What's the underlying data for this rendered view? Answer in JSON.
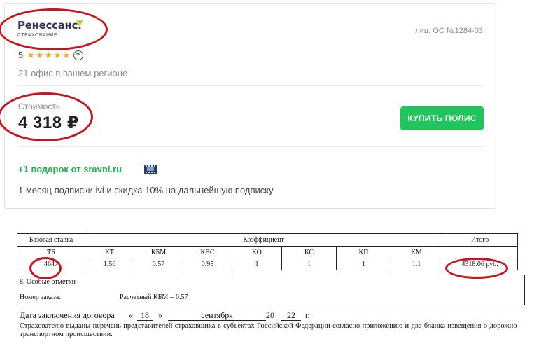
{
  "offer": {
    "brand": {
      "name": "Ренессанс.",
      "subtitle": "страхование"
    },
    "license": "лиц. ОС №1284-03",
    "rating": {
      "value": "5",
      "stars": 5,
      "help": "?"
    },
    "offices": "21 офис в вашем регионе",
    "cost_label": "Стоимость",
    "cost_value": "4 318 ₽",
    "buy_button": "КУПИТЬ ПОЛИС",
    "gift_title": "+1 подарок от sravni.ru",
    "gift_description": "1 месяц подписки ivi и скидка 10% на дальнейшую подписку",
    "colors": {
      "accent_green": "#21c55d",
      "gift_green": "#24b14f",
      "annotation_red": "#c4161c",
      "star": "#f5a623"
    }
  },
  "policy_table": {
    "headers": {
      "base_rate": "Базовая ставка",
      "coefficient": "Коэффициент",
      "total": "Итого"
    },
    "columns": [
      "ТБ",
      "КТ",
      "КБМ",
      "КВС",
      "КО",
      "КС",
      "КП",
      "КМ"
    ],
    "values": [
      "4647",
      "1.56",
      "0.57",
      "0.95",
      "1",
      "1",
      "1",
      "1.1"
    ],
    "total_value": "4318.06 руб."
  },
  "special_notes": {
    "title": "8. Особые отметки",
    "order_label": "Номер заказа:",
    "kbm_calc": "Расчетный КБМ = 0.57"
  },
  "contract": {
    "label": "Дата заключения договора",
    "open_quote": "«",
    "day": "18",
    "close_quote": "»",
    "month": "сентября",
    "century": "20",
    "year": "22",
    "year_suffix": "г."
  },
  "footer_text": "Страхователю выданы перечень представителей страховщика в субъектах Российской Федерации согласно приложению и два бланка извещения о дорожно-транспортном происшествии."
}
